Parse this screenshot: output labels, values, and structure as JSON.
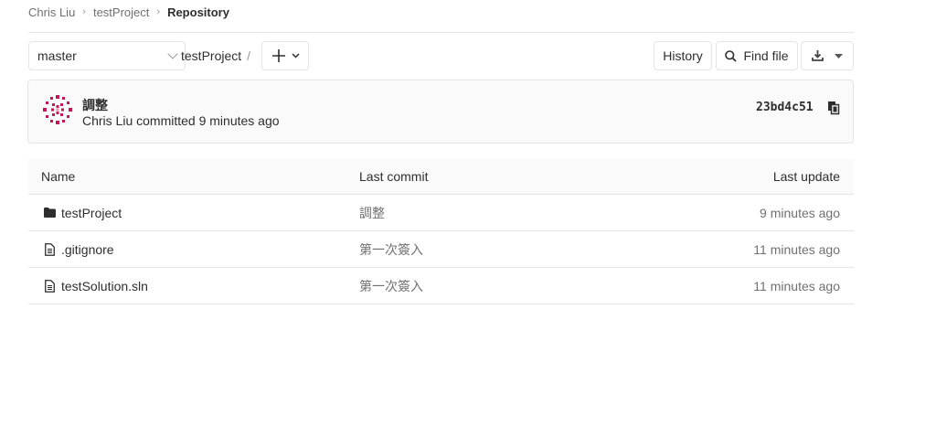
{
  "breadcrumb": {
    "items": [
      "Chris Liu",
      "testProject",
      "Repository"
    ]
  },
  "toolbar": {
    "branch": "master",
    "path": "testProject",
    "path_sep": "/",
    "history_label": "History",
    "find_file_label": "Find file"
  },
  "commit": {
    "title": "調整",
    "author_line": "Chris Liu committed 9 minutes ago",
    "sha": "23bd4c51"
  },
  "table": {
    "headers": {
      "name": "Name",
      "last_commit": "Last commit",
      "last_update": "Last update"
    },
    "rows": [
      {
        "icon": "folder-icon",
        "name": "testProject",
        "last_commit": "調整",
        "last_update": "9 minutes ago"
      },
      {
        "icon": "file-icon",
        "name": ".gitignore",
        "last_commit": "第一次簽入",
        "last_update": "11 minutes ago"
      },
      {
        "icon": "file-icon",
        "name": "testSolution.sln",
        "last_commit": "第一次簽入",
        "last_update": "11 minutes ago"
      }
    ]
  },
  "colors": {
    "avatar": "#c2185b",
    "border": "#e5e5e5",
    "muted": "#707070"
  }
}
